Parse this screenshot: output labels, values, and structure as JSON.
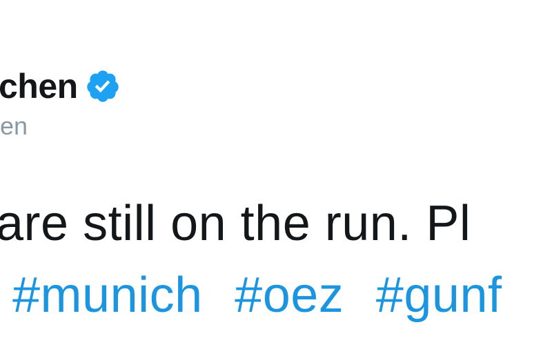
{
  "author": {
    "display_name": "chen",
    "handle": "en",
    "verified_icon": "verified-badge-icon"
  },
  "tweet": {
    "text": "are still on the run. Pl",
    "hashtags": [
      "#munich",
      "#oez",
      "#gunf"
    ]
  },
  "colors": {
    "text": "#14171a",
    "handle": "#8899a6",
    "link": "#1b95e0",
    "verified": "#1da1f2"
  }
}
